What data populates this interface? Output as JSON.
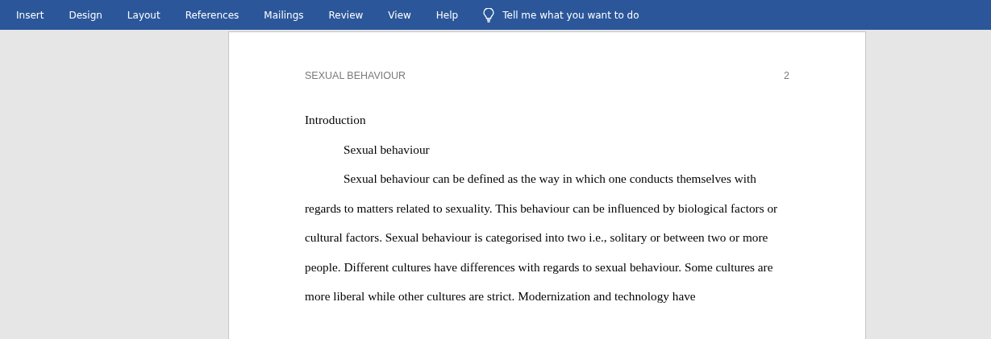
{
  "ribbon": {
    "tabs": [
      {
        "label": "Insert",
        "selected": false
      },
      {
        "label": "Design",
        "selected": false
      },
      {
        "label": "Layout",
        "selected": false
      },
      {
        "label": "References",
        "selected": false
      },
      {
        "label": "Mailings",
        "selected": false
      },
      {
        "label": "Review",
        "selected": false
      },
      {
        "label": "View",
        "selected": false
      },
      {
        "label": "Help",
        "selected": false
      }
    ],
    "tell_me": "Tell me what you want to do"
  },
  "document": {
    "header": {
      "title": "SEXUAL BEHAVIOUR",
      "page_number": "2"
    },
    "blocks": [
      {
        "kind": "heading",
        "text": "Introduction"
      },
      {
        "kind": "subheading",
        "text": "Sexual behaviour"
      },
      {
        "kind": "paragraph",
        "text": "Sexual behaviour can be defined as the way in which one conducts themselves with regards to matters related to sexuality. This behaviour can be influenced by biological factors or cultural factors. Sexual behaviour is categorised into two i.e., solitary or between two or more people. Different cultures have differences with regards to sexual behaviour. Some cultures are more liberal while other cultures are strict. Modernization and technology have"
      }
    ]
  }
}
